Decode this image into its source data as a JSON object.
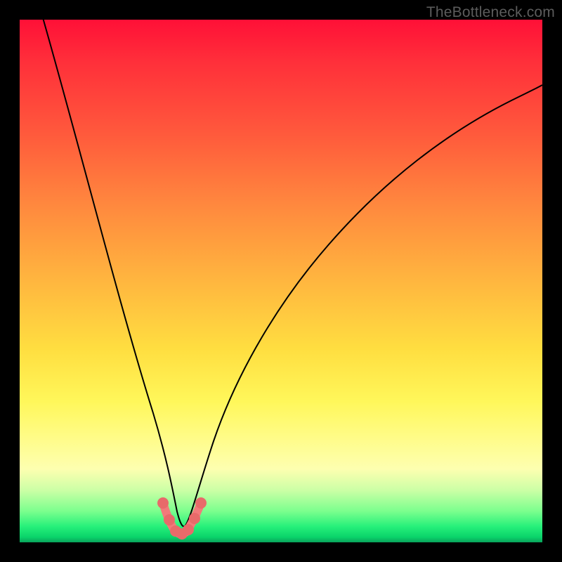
{
  "attribution": "TheBottleneck.com",
  "colors": {
    "gradient_top": "#ff1037",
    "gradient_bottom": "#0aa35b",
    "curve": "#000000",
    "marker_stroke": "#f27a7a",
    "marker_dot": "#e86a6a",
    "frame": "#000000"
  },
  "chart_data": {
    "type": "line",
    "title": "",
    "xlabel": "",
    "ylabel": "",
    "xlim": [
      0,
      100
    ],
    "ylim": [
      0,
      100
    ],
    "grid": false,
    "series": [
      {
        "name": "bottleneck-curve",
        "x": [
          0,
          5,
          10,
          15,
          20,
          22,
          24,
          26,
          27,
          28,
          29,
          30,
          31,
          32,
          33,
          34,
          36,
          38,
          40,
          45,
          50,
          55,
          60,
          65,
          70,
          75,
          80,
          85,
          90,
          95,
          100
        ],
        "values": [
          102,
          90,
          76,
          60,
          42,
          34,
          26,
          16,
          10,
          6,
          3,
          2,
          2,
          3,
          6,
          10,
          18,
          26,
          33,
          47,
          57,
          65,
          71,
          76,
          80,
          83,
          85.5,
          87.5,
          89,
          90,
          91
        ]
      }
    ],
    "markers": {
      "name": "optimal-range",
      "x": [
        27,
        28,
        29,
        30,
        31,
        32,
        33,
        34
      ],
      "values": [
        10,
        6,
        3,
        2,
        2,
        3,
        6,
        10
      ]
    }
  }
}
